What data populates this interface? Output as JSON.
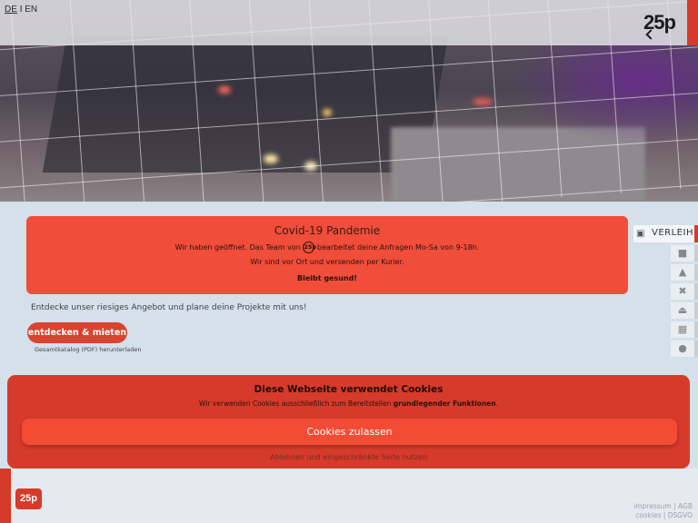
{
  "header": {
    "lang_de": "DE",
    "lang_sep": "I",
    "lang_en": "EN",
    "logo": "25p"
  },
  "covid": {
    "title": "Covid-19 Pandemie",
    "line1_before": "Wir haben geöffnet. Das Team von",
    "line1_logo": "25p",
    "line1_after": "bearbeitet deine Anfragen Mo-Sa von 9-18h.",
    "line2": "Wir sind vor Ort und versenden per Kurier.",
    "line3": "Bleibt gesund!"
  },
  "main": {
    "intro": "Entdecke unser riesiges Angebot und plane deine Projekte mit uns!",
    "explore_button": "entdecken & mieten",
    "catalog_link": "Gesamtkatalog (PDF) herunterladen"
  },
  "sidebar": {
    "verleih_label": "VERLEIH",
    "icons": [
      "shopping-bag-icon",
      "graduation-cap-icon",
      "tools-icon",
      "eject-icon",
      "film-icon",
      "group-icon"
    ]
  },
  "cookie": {
    "title": "Diese Webseite verwendet Cookies",
    "text_before": "Wir verwenden Cookies ausschließlich zum Bereitstellen",
    "text_bold": "grundlegender Funktionen",
    "text_after": ".",
    "accept_button": "Cookies zulassen",
    "decline_link": "Ablehnen und eingeschränkte Seite nutzen"
  },
  "footer": {
    "logo": "25p",
    "impressum": "impressum",
    "agb": "AGB",
    "cookies": "cookies",
    "dsgvo": "DSGVO",
    "sep": "|"
  },
  "colors": {
    "accent_red": "#d63a2a",
    "covid_red": "#f04d3a",
    "button_red": "#f24c35",
    "background": "#d4e0ea"
  }
}
